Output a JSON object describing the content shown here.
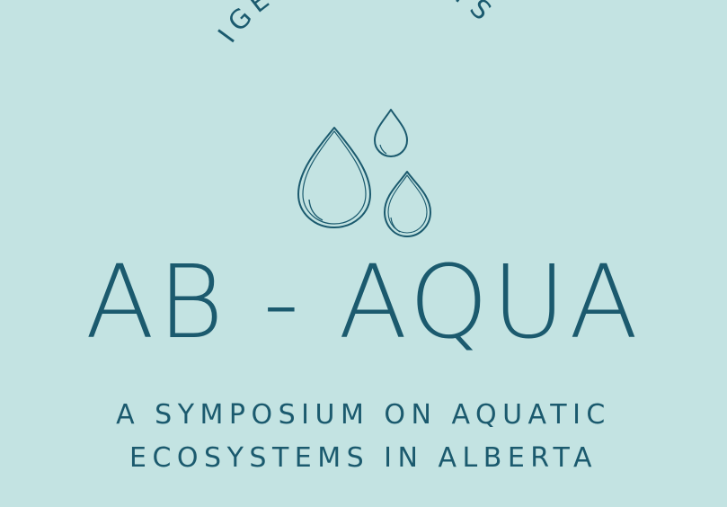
{
  "presenter": "IGEM PRESENTS",
  "title": "AB - AQUA",
  "subtitle_line1": "A SYMPOSIUM ON AQUATIC",
  "subtitle_line2": "ECOSYSTEMS IN ALBERTA",
  "colors": {
    "background": "#c3e3e2",
    "text": "#1b5a6e"
  },
  "icons": [
    "water-drop-large-icon",
    "water-drop-small-icon",
    "water-drop-medium-icon"
  ]
}
